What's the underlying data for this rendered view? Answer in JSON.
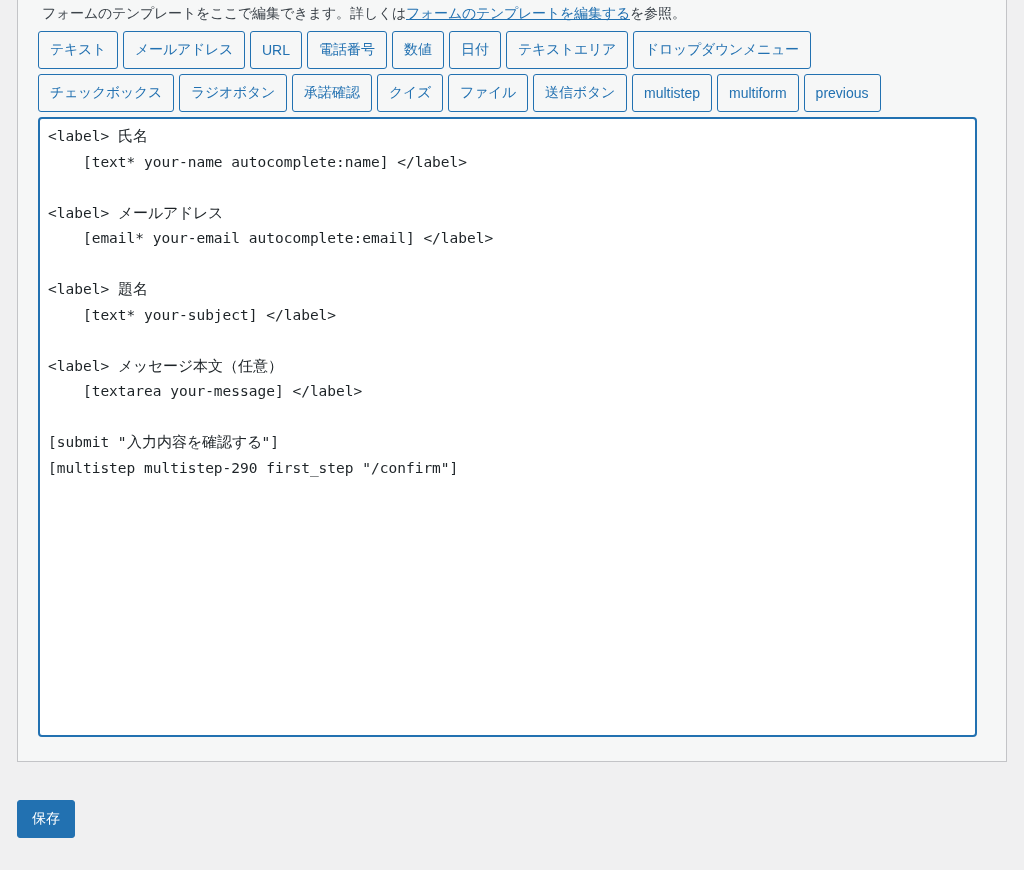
{
  "intro": {
    "text": "フォームのテンプレートをここで編集できます。詳しくは",
    "link": "フォームのテンプレートを編集する",
    "suffix": "を参照。"
  },
  "tag_buttons": [
    [
      "テキスト",
      "メールアドレス",
      "URL",
      "電話番号",
      "数値",
      "日付",
      "テキストエリア",
      "ドロップダウンメニュー"
    ],
    [
      "チェックボックス",
      "ラジオボタン",
      "承諾確認",
      "クイズ",
      "ファイル",
      "送信ボタン",
      "multistep",
      "multiform",
      "previous"
    ]
  ],
  "editor": {
    "blocks": [
      [
        "<label> 氏名",
        "    [text* your-name autocomplete:name] </label>"
      ],
      [
        "<label> メールアドレス",
        "    [email* your-email autocomplete:email] </label>"
      ],
      [
        "<label> 題名",
        "    [text* your-subject] </label>"
      ],
      [
        "<label> メッセージ本文（任意）",
        "    [textarea your-message] </label>"
      ],
      [
        "[submit \"入力内容を確認する\"]",
        "[multistep multistep-290 first_step \"/confirm\"]"
      ]
    ]
  },
  "save_button": "保存"
}
